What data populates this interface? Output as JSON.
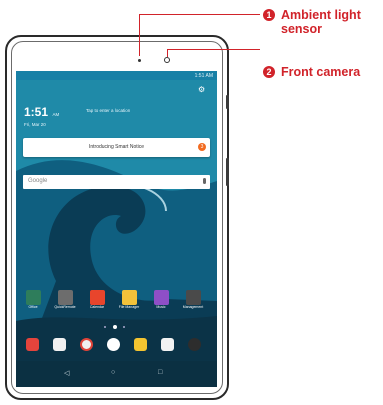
{
  "callouts": [
    {
      "number": "1",
      "label": "Ambient light sensor"
    },
    {
      "number": "2",
      "label": "Front camera"
    }
  ],
  "status_bar": {
    "time": "1:51 AM"
  },
  "home": {
    "clock": "1:51",
    "ampm": "AM",
    "date": "Fri, Mar 20",
    "location_prompt": "Tap to enter a location"
  },
  "smart_notice": {
    "text": "Introducing Smart Notice",
    "badge": "3"
  },
  "search": {
    "placeholder": "Google"
  },
  "apps": [
    {
      "label": "Office",
      "icon": "office-icon",
      "color": "#2e7d5b"
    },
    {
      "label": "QuickRemote",
      "icon": "quickremote-icon",
      "color": "#6d6d6d"
    },
    {
      "label": "Calendar",
      "icon": "calendar-icon",
      "color": "#e8452c"
    },
    {
      "label": "File Manager",
      "icon": "file-manager-icon",
      "color": "#f3c23a"
    },
    {
      "label": "Music",
      "icon": "music-icon",
      "color": "#8e4fc7"
    },
    {
      "label": "Management",
      "icon": "management-icon",
      "color": "#4a4a4a"
    }
  ],
  "dock": [
    {
      "icon": "apps-icon",
      "color": "#e4443c"
    },
    {
      "icon": "play-store-icon",
      "color": "#f1f1f1"
    },
    {
      "icon": "chrome-icon",
      "color": "#f0f0f0"
    },
    {
      "icon": "app-drawer-icon",
      "color": "#ffffff"
    },
    {
      "icon": "contacts-icon",
      "color": "#f4c430"
    },
    {
      "icon": "gallery-icon",
      "color": "#f2f2f2"
    },
    {
      "icon": "camera-icon",
      "color": "#2d2d2d"
    }
  ],
  "nav": {
    "back": "◁",
    "home": "○",
    "recent": "□"
  },
  "colors": {
    "accent": "#d1232a",
    "status_bar": "#1880a6"
  }
}
